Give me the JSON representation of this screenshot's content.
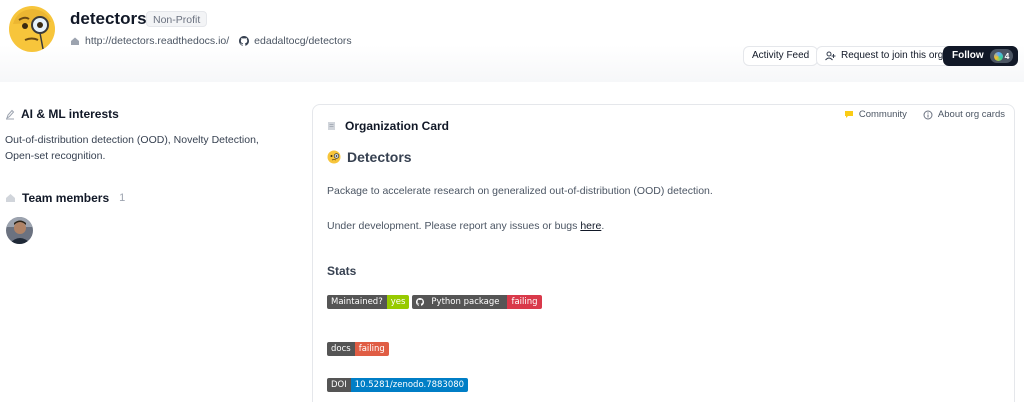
{
  "org": {
    "name": "detectors",
    "badge": "Non-Profit",
    "website": "http://detectors.readthedocs.io/",
    "github": "edadaltocg/detectors"
  },
  "header_buttons": {
    "activity_feed": "Activity Feed",
    "request_join": "Request to join this org",
    "follow": "Follow",
    "follow_count": "4"
  },
  "sidebar": {
    "interests_title": "AI & ML interests",
    "interests_text": "Out-of-distribution detection (OOD), Novelty Detection, Open-set recognition.",
    "team_title": "Team members",
    "team_count": "1"
  },
  "card": {
    "title": "Organization Card",
    "community": "Community",
    "about": "About org cards",
    "heading": "Detectors",
    "paragraph1": "Package to accelerate research on generalized out-of-distribution (OOD) detection.",
    "paragraph2_prefix": "Under development. Please report any issues or bugs ",
    "paragraph2_link": "here",
    "paragraph2_suffix": ".",
    "stats_title": "Stats",
    "badges": {
      "maintained_label": "Maintained?",
      "maintained_value": "yes",
      "python_label": "Python package",
      "python_value": "failing",
      "docs_label": "docs",
      "docs_value": "failing",
      "doi_label": "DOI",
      "doi_value": "10.5281/zenodo.7883080"
    }
  },
  "colors": {
    "badge_gray": "#555555",
    "badge_green": "#97ca00",
    "badge_red": "#e05d44",
    "badge_blue": "#007ec6",
    "follow_bg": "#111827"
  },
  "icons": {
    "org_avatar": "face-with-monocle-icon",
    "website": "home-icon",
    "github": "github-icon",
    "join": "user-plus-icon",
    "interests": "pencil-icon",
    "team": "people-icon",
    "card": "document-icon",
    "community": "chat-bubble-icon",
    "about": "info-icon",
    "detectors": "face-with-monocle-icon"
  }
}
